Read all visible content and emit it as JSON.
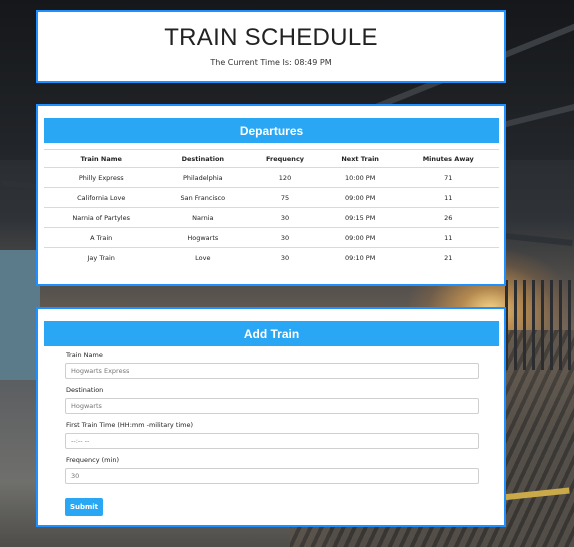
{
  "header": {
    "title": "TRAIN SCHEDULE",
    "current_time_label": "The Current Time Is: 08:49 PM"
  },
  "departures": {
    "title": "Departures",
    "columns": [
      "Train Name",
      "Destination",
      "Frequency",
      "Next Train",
      "Minutes Away"
    ],
    "rows": [
      [
        "Philly Express",
        "Philadelphia",
        "120",
        "10:00 PM",
        "71"
      ],
      [
        "California Love",
        "San Francisco",
        "75",
        "09:00 PM",
        "11"
      ],
      [
        "Narnia of Partyles",
        "Narnia",
        "30",
        "09:15 PM",
        "26"
      ],
      [
        "A Train",
        "Hogwarts",
        "30",
        "09:00 PM",
        "11"
      ],
      [
        "Jay Train",
        "Love",
        "30",
        "09:10 PM",
        "21"
      ]
    ]
  },
  "add_train": {
    "title": "Add Train",
    "fields": [
      {
        "label": "Train Name",
        "placeholder": "Hogwarts Express"
      },
      {
        "label": "Destination",
        "placeholder": "Hogwarts"
      },
      {
        "label": "First Train Time (HH:mm -military time)",
        "placeholder": "--:-- --"
      },
      {
        "label": "Frequency (min)",
        "placeholder": "30"
      }
    ],
    "submit_label": "Submit"
  },
  "colors": {
    "accent": "#29a7f5",
    "panel_border": "#1e90ff"
  }
}
